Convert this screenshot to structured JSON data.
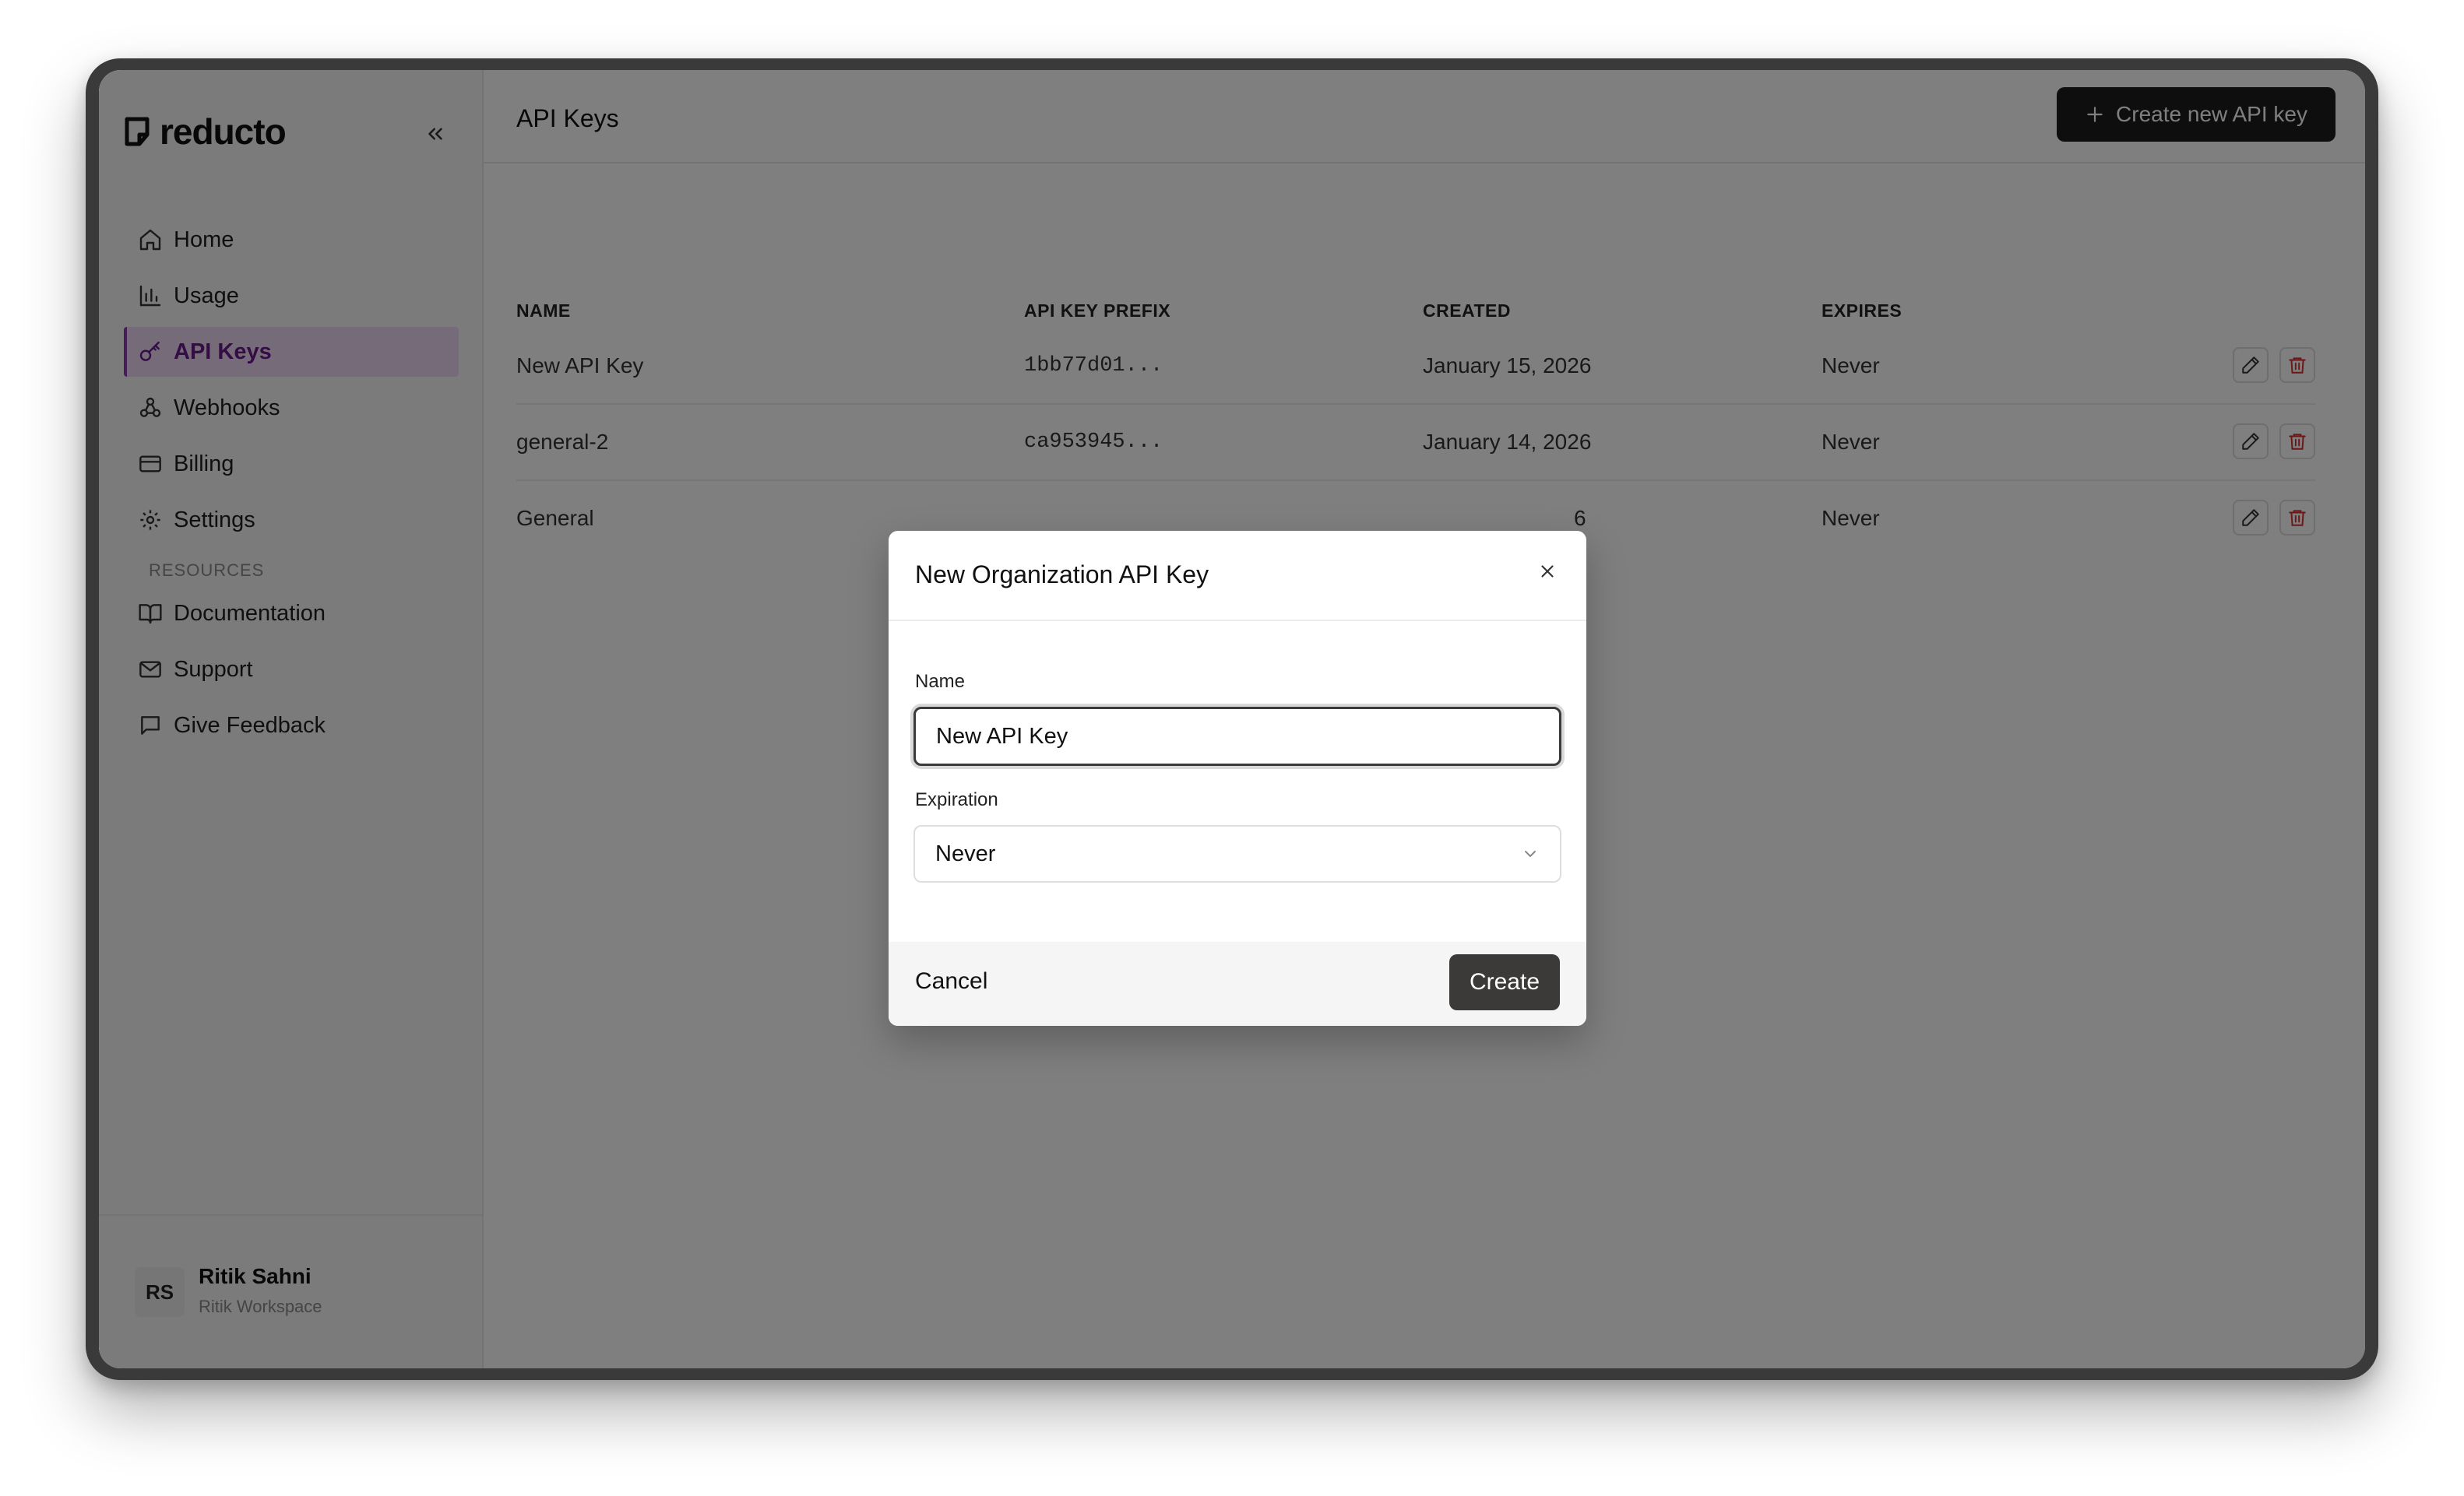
{
  "app": {
    "name": "reducto"
  },
  "sidebar": {
    "items": [
      {
        "label": "Home",
        "icon": "home-icon"
      },
      {
        "label": "Usage",
        "icon": "bar-chart-icon"
      },
      {
        "label": "API Keys",
        "icon": "key-icon",
        "active": true
      },
      {
        "label": "Webhooks",
        "icon": "webhook-icon"
      },
      {
        "label": "Billing",
        "icon": "credit-card-icon"
      },
      {
        "label": "Settings",
        "icon": "gear-icon"
      }
    ],
    "resources_label": "RESOURCES",
    "resources": [
      {
        "label": "Documentation",
        "icon": "book-icon"
      },
      {
        "label": "Support",
        "icon": "mail-icon"
      },
      {
        "label": "Give Feedback",
        "icon": "message-icon"
      }
    ],
    "user": {
      "initials": "RS",
      "name": "Ritik Sahni",
      "workspace": "Ritik Workspace"
    }
  },
  "header": {
    "title": "API Keys",
    "create_button": "Create new API key"
  },
  "table": {
    "columns": [
      "NAME",
      "API KEY PREFIX",
      "CREATED",
      "EXPIRES"
    ],
    "rows": [
      {
        "name": "New API Key",
        "prefix": "1bb77d01...",
        "created": "January 15, 2026",
        "expires": "Never"
      },
      {
        "name": "general-2",
        "prefix": "ca953945...",
        "created": "January 14, 2026",
        "expires": "Never"
      },
      {
        "name": "General",
        "prefix": "",
        "created": "6",
        "expires": "Never"
      }
    ]
  },
  "modal": {
    "title": "New Organization API Key",
    "name_label": "Name",
    "name_value": "New API Key",
    "expiration_label": "Expiration",
    "expiration_value": "Never",
    "cancel_label": "Cancel",
    "create_label": "Create"
  },
  "colors": {
    "accent": "#6a1b8a",
    "active_bg": "#ecd9f3",
    "danger": "#d32f2f",
    "primary_button": "#1d1d1d"
  }
}
